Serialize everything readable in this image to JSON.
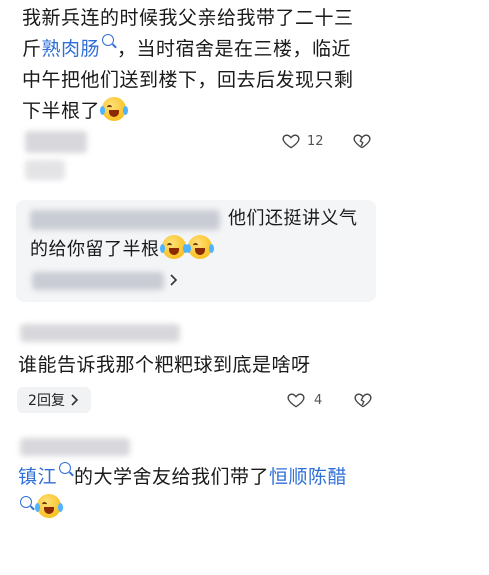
{
  "comment1": {
    "line1": "我新兵连的时候我父亲给我带了二十三",
    "line2_prefix": "斤",
    "line2_link": "熟肉肠",
    "line2_suffix": "，当时宿舍是在三楼，临近",
    "line3": "中午把他们送到楼下，回去后发现只剩",
    "line4": "下半根了",
    "like_count": "12"
  },
  "reply1": {
    "text_a": "他们还挺讲义气",
    "text_b": "的给你留了半根"
  },
  "comment2": {
    "text": "谁能告诉我那个粑粑球到底是啥呀",
    "replies_label": "2回复",
    "like_count": "4"
  },
  "comment3": {
    "link1": "镇江",
    "mid": "的大学舍友给我们带了",
    "link2": "恒顺陈醋"
  },
  "colors": {
    "link": "#2f6fd6",
    "text": "#1a1a1a"
  },
  "icons": [
    "search-icon",
    "heart-icon",
    "broken-heart-icon",
    "chevron-right-icon",
    "crying-laughing-emoji"
  ]
}
